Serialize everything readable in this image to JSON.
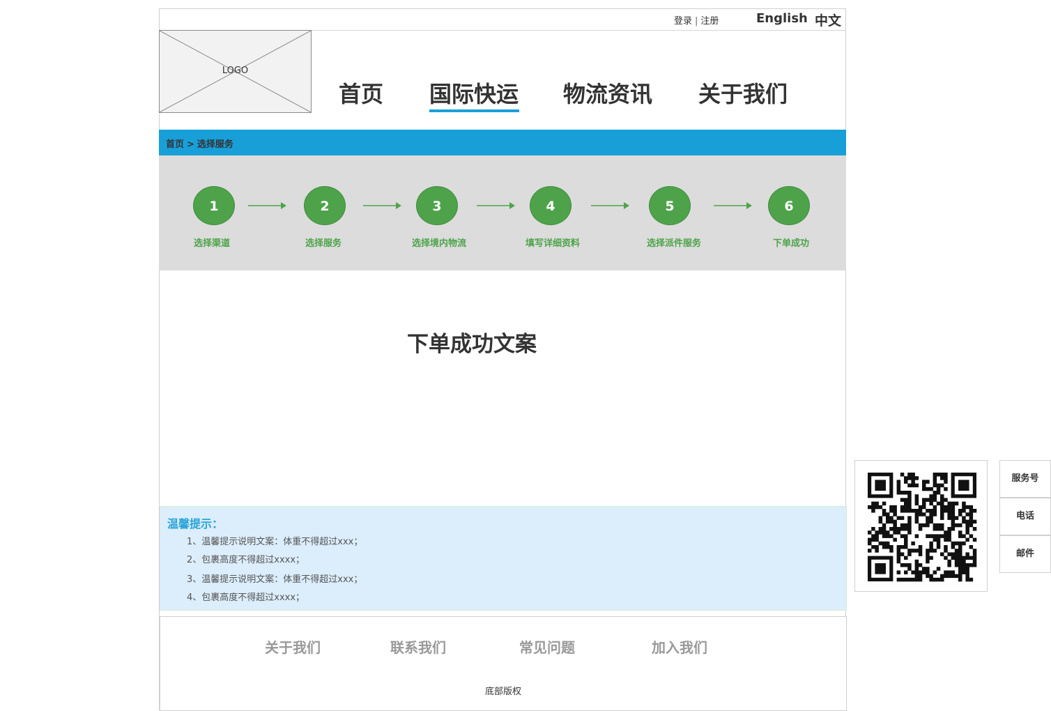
{
  "topbar": {
    "login": "登录",
    "separator": "|",
    "register": "注册",
    "lang_en": "English",
    "lang_zh": "中文"
  },
  "logo": {
    "text": "LOGO"
  },
  "nav": {
    "items": [
      {
        "label": "首页"
      },
      {
        "label": "国际快运"
      },
      {
        "label": "物流资讯"
      },
      {
        "label": "关于我们"
      }
    ],
    "active": "国际快运",
    "accent_color": "#1ba0d8"
  },
  "breadcrumb": {
    "home": "首页",
    "separator": ">",
    "current": "选择服务"
  },
  "steps": [
    {
      "number": "1",
      "label": "选择渠道"
    },
    {
      "number": "2",
      "label": "选择服务"
    },
    {
      "number": "3",
      "label": "选择境内物流"
    },
    {
      "number": "4",
      "label": "填写详细资料"
    },
    {
      "number": "5",
      "label": "选择派件服务"
    },
    {
      "number": "6",
      "label": "下单成功"
    }
  ],
  "step_color": "#4ea34a",
  "main": {
    "title": "下单成功文案"
  },
  "tips": {
    "title": "温馨提示：",
    "items": [
      "1、温馨提示说明文案：体重不得超过xxx；",
      "2、包裹高度不得超过xxxx；",
      "3、温馨提示说明文案：体重不得超过xxx；",
      "4、包裹高度不得超过xxxx；"
    ]
  },
  "footer": {
    "links": [
      "关于我们",
      "联系我们",
      "常见问题",
      "加入我们"
    ],
    "copyright": "底部版权"
  },
  "side": {
    "items": [
      "服务号",
      "电话",
      "邮件"
    ]
  }
}
